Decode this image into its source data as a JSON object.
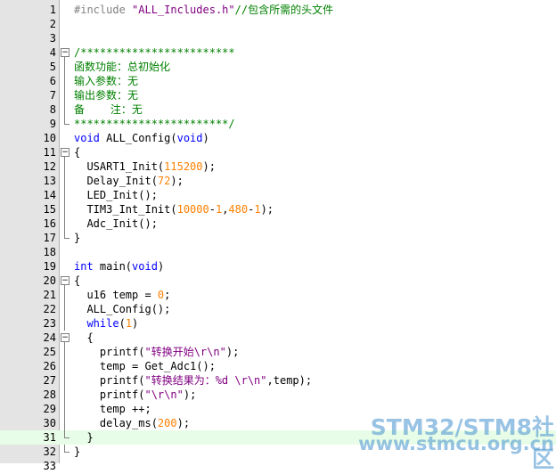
{
  "editor": {
    "current_line": 31,
    "lines": [
      {
        "n": "1",
        "fold": "",
        "segs": [
          {
            "t": "pp",
            "v": "#include "
          },
          {
            "t": "str",
            "v": "\"ALL_Includes.h\""
          },
          {
            "t": "cm",
            "v": "//包含所需的头文件"
          }
        ]
      },
      {
        "n": "2",
        "fold": "",
        "segs": []
      },
      {
        "n": "3",
        "fold": "",
        "segs": []
      },
      {
        "n": "4",
        "fold": "box cont",
        "segs": [
          {
            "t": "cm",
            "v": "/************************"
          }
        ]
      },
      {
        "n": "5",
        "fold": "vline",
        "segs": [
          {
            "t": "cm",
            "v": "函数功能：总初始化"
          }
        ]
      },
      {
        "n": "6",
        "fold": "vline",
        "segs": [
          {
            "t": "cm",
            "v": "输入参数：无"
          }
        ]
      },
      {
        "n": "7",
        "fold": "vline",
        "segs": [
          {
            "t": "cm",
            "v": "输出参数：无"
          }
        ]
      },
      {
        "n": "8",
        "fold": "vline",
        "segs": [
          {
            "t": "cm",
            "v": "备    注：无"
          }
        ]
      },
      {
        "n": "9",
        "fold": "end",
        "segs": [
          {
            "t": "cm",
            "v": "************************/"
          }
        ]
      },
      {
        "n": "10",
        "fold": "",
        "segs": [
          {
            "t": "kw",
            "v": "void"
          },
          {
            "t": "pl",
            "v": " ALL_Config("
          },
          {
            "t": "kw",
            "v": "void"
          },
          {
            "t": "pl",
            "v": ")"
          }
        ]
      },
      {
        "n": "11",
        "fold": "box cont",
        "segs": [
          {
            "t": "pl",
            "v": "{"
          }
        ]
      },
      {
        "n": "12",
        "fold": "vline",
        "segs": [
          {
            "t": "pl",
            "v": "  USART1_Init("
          },
          {
            "t": "num",
            "v": "115200"
          },
          {
            "t": "pl",
            "v": ");"
          }
        ]
      },
      {
        "n": "13",
        "fold": "vline",
        "segs": [
          {
            "t": "pl",
            "v": "  Delay_Init("
          },
          {
            "t": "num",
            "v": "72"
          },
          {
            "t": "pl",
            "v": ");"
          }
        ]
      },
      {
        "n": "14",
        "fold": "vline",
        "segs": [
          {
            "t": "pl",
            "v": "  LED_Init();"
          }
        ]
      },
      {
        "n": "15",
        "fold": "vline",
        "segs": [
          {
            "t": "pl",
            "v": "  TIM3_Int_Init("
          },
          {
            "t": "num",
            "v": "10000"
          },
          {
            "t": "pl",
            "v": "-"
          },
          {
            "t": "num",
            "v": "1"
          },
          {
            "t": "pl",
            "v": ","
          },
          {
            "t": "num",
            "v": "480"
          },
          {
            "t": "pl",
            "v": "-"
          },
          {
            "t": "num",
            "v": "1"
          },
          {
            "t": "pl",
            "v": ");"
          }
        ]
      },
      {
        "n": "16",
        "fold": "vline",
        "segs": [
          {
            "t": "pl",
            "v": "  Adc_Init();"
          }
        ]
      },
      {
        "n": "17",
        "fold": "end",
        "segs": [
          {
            "t": "pl",
            "v": "}"
          }
        ]
      },
      {
        "n": "18",
        "fold": "",
        "segs": []
      },
      {
        "n": "19",
        "fold": "",
        "segs": [
          {
            "t": "kw",
            "v": "int"
          },
          {
            "t": "pl",
            "v": " main("
          },
          {
            "t": "kw",
            "v": "void"
          },
          {
            "t": "pl",
            "v": ")"
          }
        ]
      },
      {
        "n": "20",
        "fold": "box cont",
        "segs": [
          {
            "t": "pl",
            "v": "{"
          }
        ]
      },
      {
        "n": "21",
        "fold": "vline",
        "segs": [
          {
            "t": "pl",
            "v": "  u16 temp = "
          },
          {
            "t": "num",
            "v": "0"
          },
          {
            "t": "pl",
            "v": ";"
          }
        ]
      },
      {
        "n": "22",
        "fold": "vline",
        "segs": [
          {
            "t": "pl",
            "v": "  ALL_Config();"
          }
        ]
      },
      {
        "n": "23",
        "fold": "vline",
        "segs": [
          {
            "t": "pl",
            "v": "  "
          },
          {
            "t": "kw",
            "v": "while"
          },
          {
            "t": "pl",
            "v": "("
          },
          {
            "t": "num",
            "v": "1"
          },
          {
            "t": "pl",
            "v": ")"
          }
        ]
      },
      {
        "n": "24",
        "fold": "box cont",
        "segs": [
          {
            "t": "pl",
            "v": "  {"
          }
        ]
      },
      {
        "n": "25",
        "fold": "vline",
        "segs": [
          {
            "t": "pl",
            "v": "    printf("
          },
          {
            "t": "str",
            "v": "\"转换开始\\r\\n\""
          },
          {
            "t": "pl",
            "v": ");"
          }
        ]
      },
      {
        "n": "26",
        "fold": "vline",
        "segs": [
          {
            "t": "pl",
            "v": "    temp = Get_Adc1();"
          }
        ]
      },
      {
        "n": "27",
        "fold": "vline",
        "segs": [
          {
            "t": "pl",
            "v": "    printf("
          },
          {
            "t": "str",
            "v": "\"转换结果为：%d \\r\\n\""
          },
          {
            "t": "pl",
            "v": ",temp);"
          }
        ]
      },
      {
        "n": "28",
        "fold": "vline",
        "segs": [
          {
            "t": "pl",
            "v": "    printf("
          },
          {
            "t": "str",
            "v": "\"\\r\\n\""
          },
          {
            "t": "pl",
            "v": ");"
          }
        ]
      },
      {
        "n": "29",
        "fold": "vline",
        "segs": [
          {
            "t": "pl",
            "v": "    temp ++;"
          }
        ]
      },
      {
        "n": "30",
        "fold": "vline",
        "segs": [
          {
            "t": "pl",
            "v": "    delay_ms("
          },
          {
            "t": "num",
            "v": "200"
          },
          {
            "t": "pl",
            "v": ");"
          }
        ]
      },
      {
        "n": "31",
        "fold": "end",
        "segs": [
          {
            "t": "pl",
            "v": "  }"
          }
        ]
      },
      {
        "n": "32",
        "fold": "end",
        "segs": [
          {
            "t": "pl",
            "v": "}"
          }
        ]
      },
      {
        "n": "33",
        "fold": "",
        "segs": []
      }
    ]
  },
  "watermark": {
    "line1": "STM32/STM8社区",
    "line2": "www.stmcu.org.cn"
  }
}
